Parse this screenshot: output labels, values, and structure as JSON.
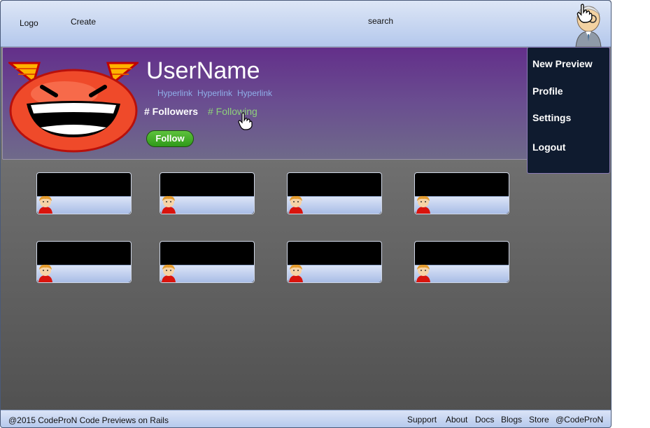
{
  "nav": {
    "logo": "Logo",
    "create": "Create",
    "search": "search"
  },
  "profile": {
    "username": "UserName",
    "hyperlinks": [
      "Hyperlink",
      "Hyperlink",
      "Hyperlink"
    ],
    "followers": "# Followers",
    "following": "# Following",
    "follow_button": "Follow"
  },
  "menu": {
    "items": [
      "New Preview",
      "Profile",
      "Settings",
      "Logout"
    ]
  },
  "cards": {
    "count": 8
  },
  "footer": {
    "copyright": "@2015 CodeProN Code Previews on Rails",
    "links": [
      "Support",
      "About",
      "Docs",
      "Blogs",
      "Store",
      "@CodeProN"
    ]
  },
  "colors": {
    "banner_top": "#632f8a",
    "follow_button": "#3aa420",
    "following_text": "#8ed07a",
    "menu_bg": "#0f1b2f",
    "hyperlink": "#8fb0ea"
  },
  "icons": [
    "user-avatar-icon",
    "hand-cursor-icon",
    "devil-face-icon",
    "thumbnail-avatar-icon"
  ]
}
